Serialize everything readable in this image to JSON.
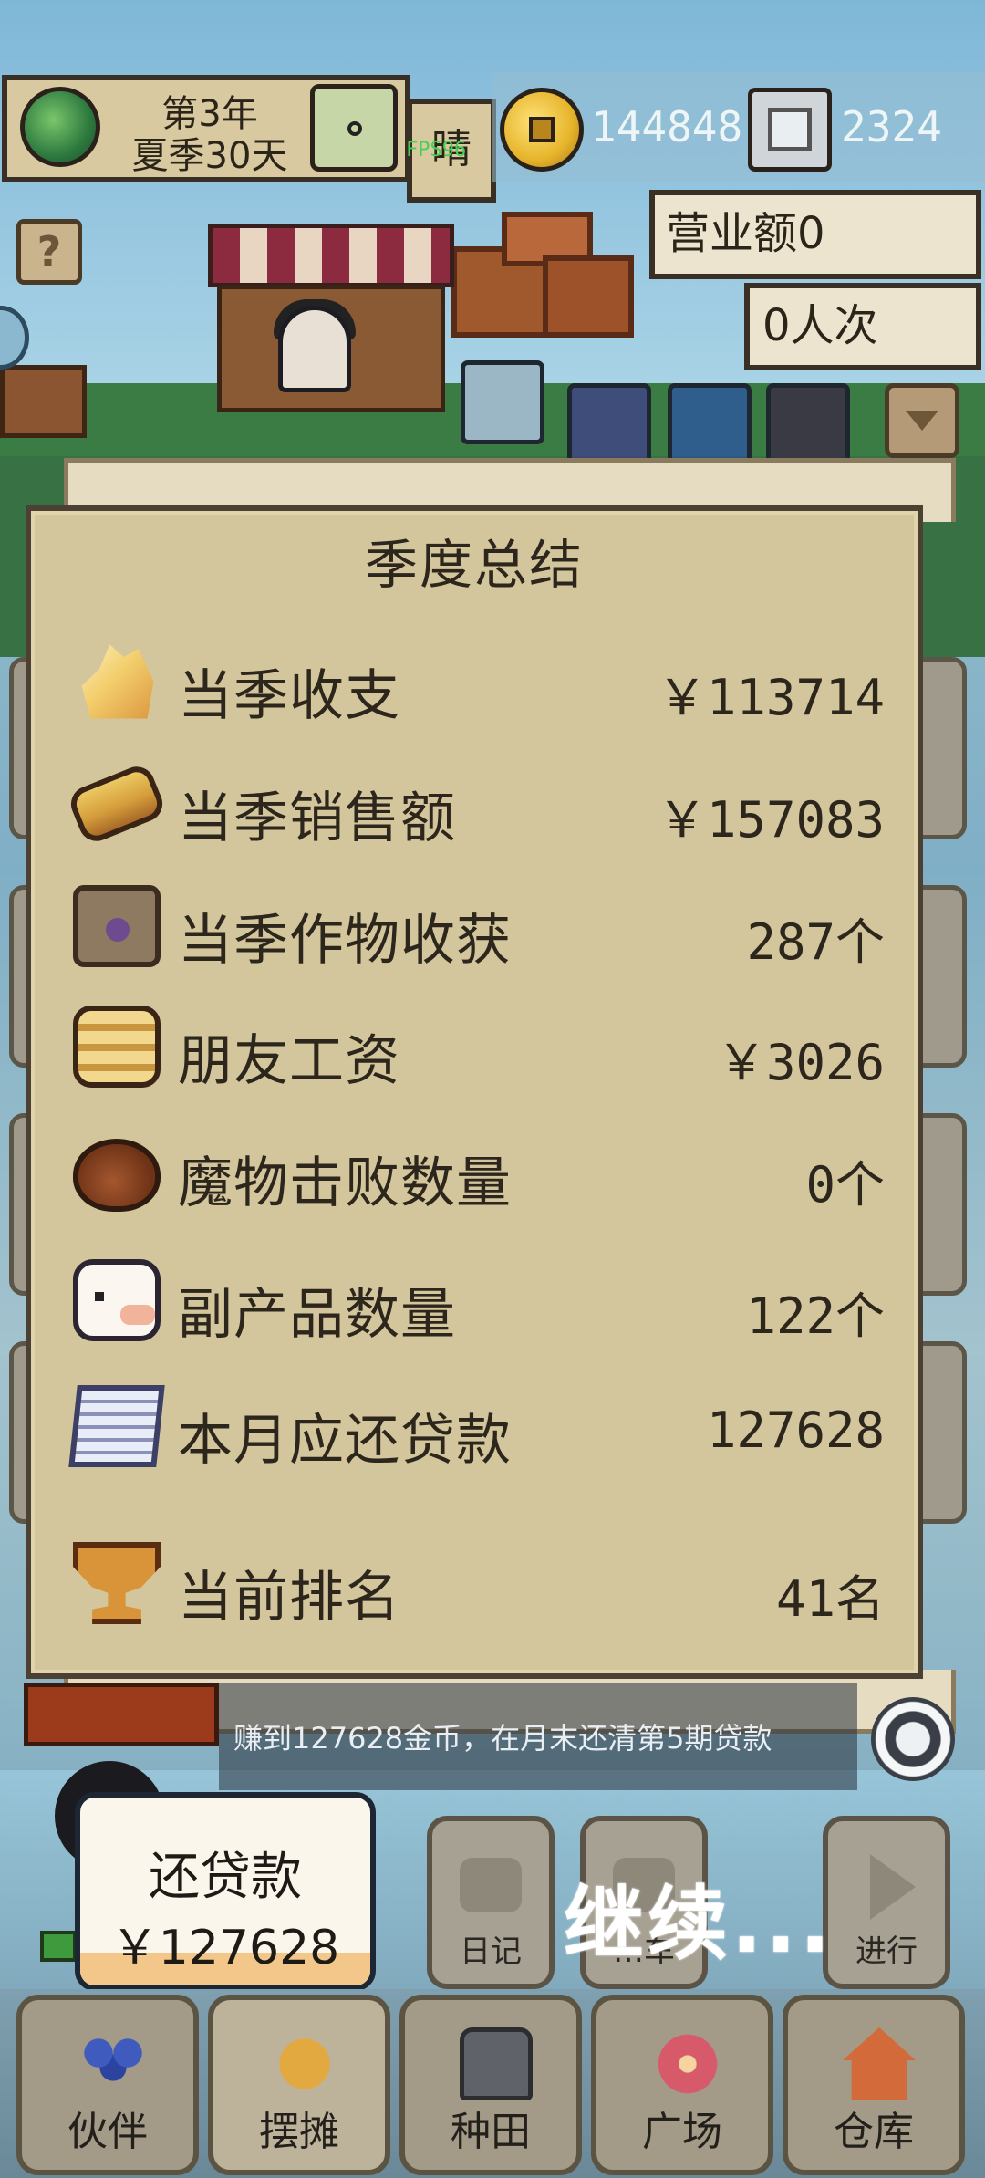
{
  "hud": {
    "year": "第3年",
    "season_day": "夏季30天",
    "weather": "晴",
    "fps": "FPS96",
    "gold": "144848",
    "silver": "2324",
    "revenue": "营业额0",
    "visits": "0人次"
  },
  "summary": {
    "title": "季度总结",
    "rows": [
      {
        "label": "当季收支",
        "value": "￥113714",
        "icon": "crystal-icon"
      },
      {
        "label": "当季销售额",
        "value": "￥157083",
        "icon": "bread-icon"
      },
      {
        "label": "当季作物收获",
        "value": "287个",
        "icon": "seed-bag-icon"
      },
      {
        "label": "朋友工资",
        "value": "￥3026",
        "icon": "scroll-wage-icon"
      },
      {
        "label": "魔物击败数量",
        "value": "0个",
        "icon": "loot-pouch-icon"
      },
      {
        "label": "副产品数量",
        "value": "122个",
        "icon": "byproduct-icon"
      },
      {
        "label": "本月应还贷款",
        "value": "127628",
        "icon": "document-icon"
      },
      {
        "label": "当前排名",
        "value": "41名",
        "icon": "trophy-icon"
      }
    ]
  },
  "feed": {
    "text": "赚到127628金币，在月末还清第5期贷款"
  },
  "loan_card": {
    "title": "还贷款",
    "value": "￥127628"
  },
  "actions": {
    "diary": "日记",
    "mid": "…车",
    "go": "进行",
    "continue": "继续..."
  },
  "nav": [
    {
      "label": "伙伴",
      "icon": "people-icon"
    },
    {
      "label": "摆摊",
      "icon": "stall-icon"
    },
    {
      "label": "种田",
      "icon": "watering-can-icon"
    },
    {
      "label": "广场",
      "icon": "flower-icon"
    },
    {
      "label": "仓库",
      "icon": "house-icon"
    }
  ],
  "colors": {
    "panel": "#d4c69c",
    "panel_border": "#4c4033",
    "text": "#2c261c"
  }
}
